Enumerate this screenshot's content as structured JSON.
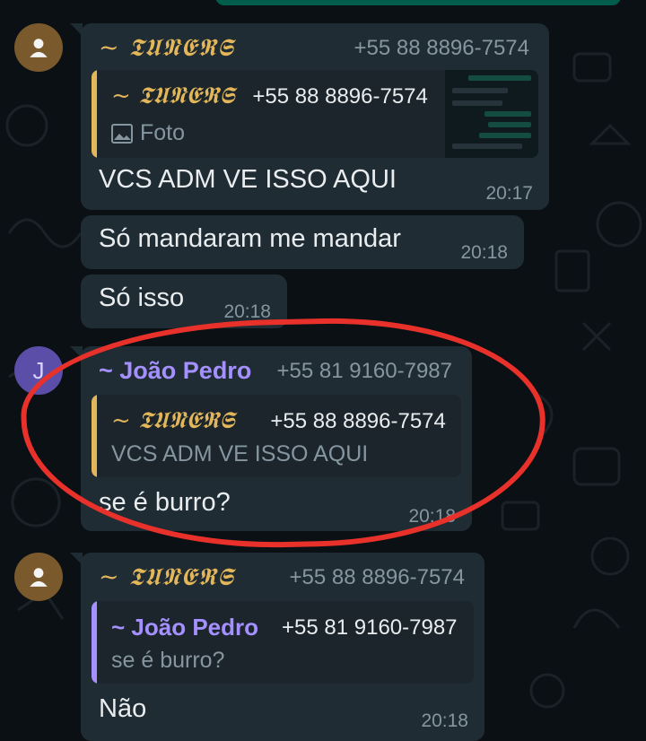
{
  "messages": [
    {
      "sender": "~ 𝕿𝖀𝕹𝕰𝕽𝕾",
      "phone": "+55 88 8896-7574",
      "quote": {
        "sender": "~ 𝕿𝖀𝕹𝕰𝕽𝕾",
        "phone": "+55 88 8896-7574",
        "text": "Foto",
        "media_icon": "image-icon"
      },
      "text": "VCS ADM VE ISSO AQUI",
      "time": "20:17"
    },
    {
      "text": "Só mandaram me mandar",
      "time": "20:18"
    },
    {
      "text": "Só isso",
      "time": "20:18"
    },
    {
      "avatar_letter": "J",
      "sender": "~ João Pedro",
      "phone": "+55 81 9160-7987",
      "quote": {
        "sender": "~ 𝕿𝖀𝕹𝕰𝕽𝕾",
        "phone": "+55 88 8896-7574",
        "text": "VCS ADM VE ISSO AQUI"
      },
      "text": "se é burro?",
      "time": "20:18"
    },
    {
      "sender": "~ 𝕿𝖀𝕹𝕰𝕽𝕾",
      "phone": "+55 88 8896-7574",
      "quote": {
        "sender": "~ João Pedro",
        "phone": "+55 81 9160-7987",
        "text": "se é burro?"
      },
      "text": "Não",
      "time": "20:18"
    }
  ],
  "colors": {
    "bubble": "#202c33",
    "quote_bar_gold": "#e3b65a",
    "quote_bar_purple": "#a590ff",
    "annotation": "#e8312a"
  }
}
